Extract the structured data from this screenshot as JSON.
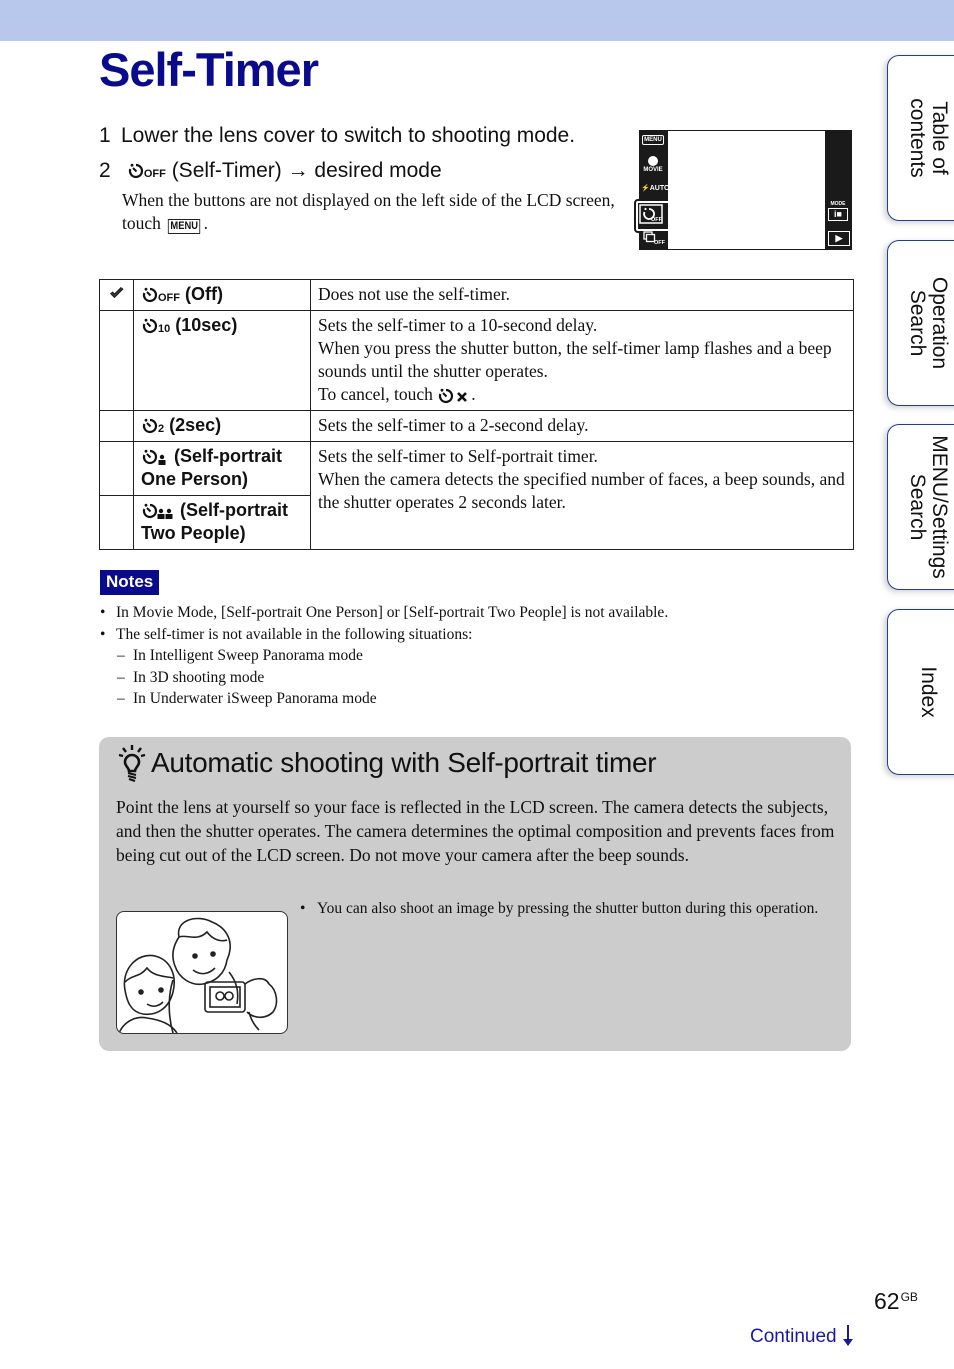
{
  "page": {
    "title": "Self-Timer",
    "page_number": "62",
    "page_number_suffix": "GB",
    "continued_label": "Continued",
    "continued_icon": "arrow-down-icon",
    "header_band_color": "#b8c8ec",
    "accent_color": "#0a0a8c"
  },
  "side_tabs": [
    {
      "label_line1": "Table of",
      "label_line2": "contents"
    },
    {
      "label_line1": "Operation",
      "label_line2": "Search"
    },
    {
      "label_line1": "MENU/Settings",
      "label_line2": "Search"
    },
    {
      "label_line1": "Index",
      "label_line2": ""
    }
  ],
  "steps": [
    {
      "num": "1",
      "text": "Lower the lens cover to switch to shooting mode."
    },
    {
      "num": "2",
      "icon": "self-timer-off-icon",
      "icon_sub": "OFF",
      "text": "(Self-Timer)",
      "arrow": "→",
      "text2": "desired mode"
    }
  ],
  "step2_note": {
    "before": "When the buttons are not displayed on the left side of the LCD screen, touch",
    "chip": "MENU",
    "after": "."
  },
  "lcd": {
    "left_buttons": [
      "MENU",
      "MOVIE",
      "AUTO",
      "OFF",
      "OFF"
    ],
    "right_buttons": [
      "MODE",
      "playback"
    ],
    "selected": "self-timer"
  },
  "table": {
    "rows": [
      {
        "checked": true,
        "icon_sub": "OFF",
        "name": "(Off)",
        "desc": [
          "Does not use the self-timer."
        ]
      },
      {
        "checked": false,
        "icon_sub": "10",
        "name": "(10sec)",
        "desc": [
          "Sets the self-timer to a 10-second delay.",
          "When you press the shutter button, the self-timer lamp flashes and a beep sounds until the shutter operates."
        ],
        "cancel_text": "To cancel, touch",
        "cancel_after": "."
      },
      {
        "checked": false,
        "icon_sub": "2",
        "name": "(2sec)",
        "desc": [
          "Sets the self-timer to a 2-second delay."
        ]
      },
      {
        "checked": false,
        "icon_sub": "one-person",
        "name": "(Self-portrait One Person)",
        "desc": [
          "Sets the self-timer to Self-portrait timer.",
          "When the camera detects the specified number of faces, a beep sounds, and the shutter operates 2 seconds later."
        ]
      },
      {
        "checked": false,
        "icon_sub": "two-people",
        "name": "(Self-portrait Two People)"
      }
    ]
  },
  "notes": {
    "badge": "Notes",
    "items": [
      {
        "type": "bullet",
        "text": "In Movie Mode, [Self-portrait One Person] or [Self-portrait Two People] is not available."
      },
      {
        "type": "bullet",
        "text": "The self-timer is not available in the following situations:"
      },
      {
        "type": "dash",
        "text": "In Intelligent Sweep Panorama mode"
      },
      {
        "type": "dash",
        "text": "In 3D shooting mode"
      },
      {
        "type": "dash",
        "text": "In Underwater iSweep Panorama mode"
      }
    ]
  },
  "hint": {
    "icon": "lightbulb-icon",
    "title": "Automatic shooting with Self-portrait timer",
    "body": "Point the lens at yourself so your face is reflected in the LCD screen. The camera detects the subjects, and then the shutter operates. The camera determines the optimal composition and prevents faces from being cut out of the LCD screen. Do not move your camera after the beep sounds.",
    "tip": "You can also shoot an image by pressing the shutter button during this operation.",
    "illustration": "two-people-selfie-illustration"
  }
}
